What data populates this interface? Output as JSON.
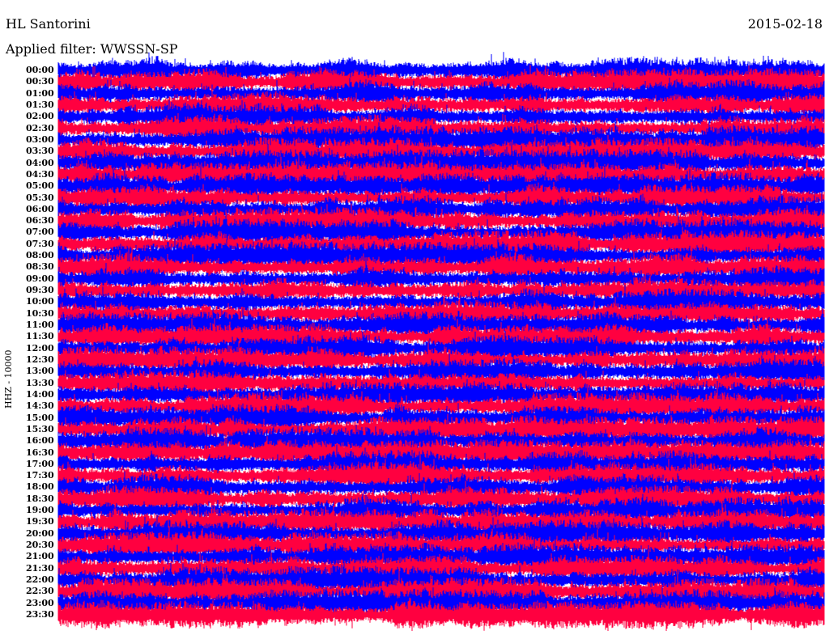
{
  "header": {
    "station": "HL Santorini",
    "date": "2015-02-18",
    "filter": "Applied filter: WWSSN-SP"
  },
  "chart_data": {
    "type": "line",
    "title": "HL Santorini",
    "subtitle": "Applied filter: WWSSN-SP",
    "ylabel": "HHZ - 10000",
    "xlabel": "",
    "row_labels": [
      "00:00",
      "00:30",
      "01:00",
      "01:30",
      "02:00",
      "02:30",
      "03:00",
      "03:30",
      "04:00",
      "04:30",
      "05:00",
      "05:30",
      "06:00",
      "06:30",
      "07:00",
      "07:30",
      "08:00",
      "08:30",
      "09:00",
      "09:30",
      "10:00",
      "10:30",
      "11:00",
      "11:30",
      "12:00",
      "12:30",
      "13:00",
      "13:30",
      "14:00",
      "14:30",
      "15:00",
      "15:30",
      "16:00",
      "16:30",
      "17:00",
      "17:30",
      "18:00",
      "18:30",
      "19:00",
      "19:30",
      "20:00",
      "20:30",
      "21:00",
      "21:30",
      "22:00",
      "22:30",
      "23:00",
      "23:30"
    ],
    "series_colors": [
      "#0000ff",
      "#ff0040"
    ],
    "grid": false
  }
}
